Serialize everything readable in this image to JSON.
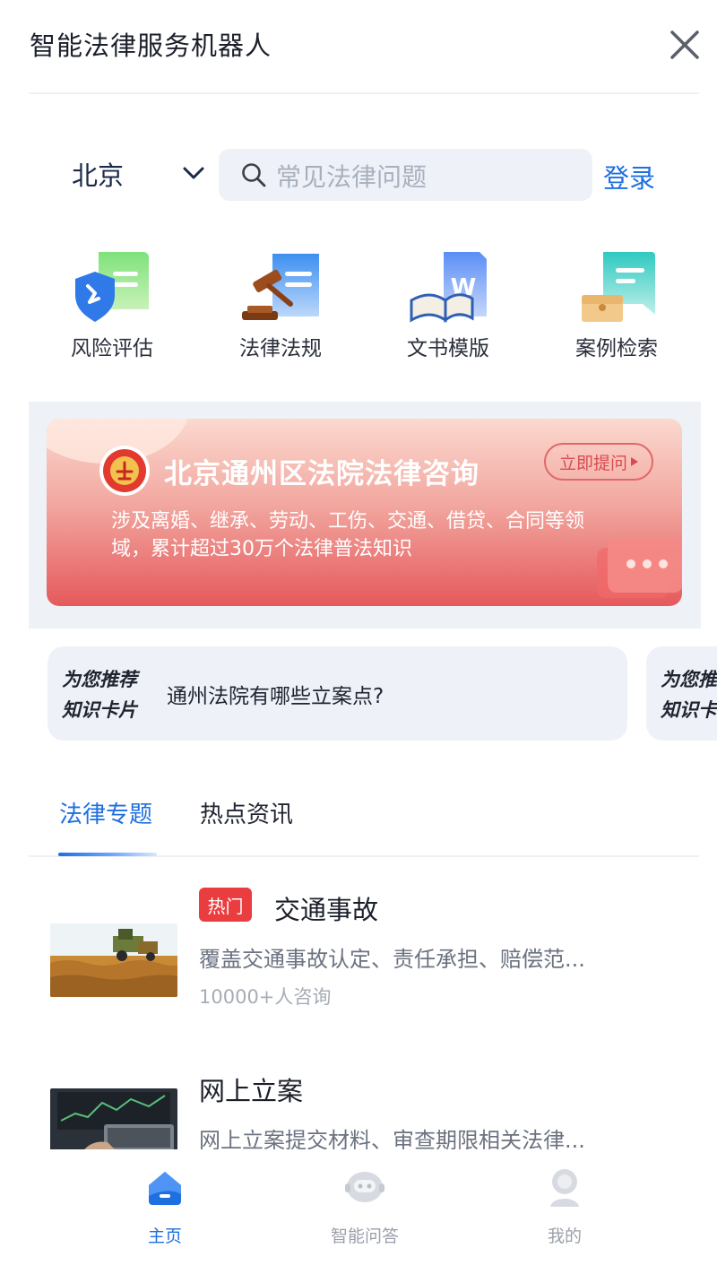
{
  "header": {
    "title": "智能法律服务机器人"
  },
  "search": {
    "city": "北京",
    "placeholder": "常见法律问题",
    "login_label": "登录"
  },
  "quick_entries": [
    {
      "label": "风险评估",
      "icon": "shield-document-icon"
    },
    {
      "label": "法律法规",
      "icon": "gavel-document-icon"
    },
    {
      "label": "文书模版",
      "icon": "word-book-icon"
    },
    {
      "label": "案例检索",
      "icon": "folder-chat-icon"
    }
  ],
  "banner": {
    "title": "北京通州区法院法律咨询",
    "cta_label": "立即提问",
    "description": "涉及离婚、继承、劳动、工伤、交通、借贷、合同等领域，累计超过30万个法律普法知识"
  },
  "knowledge_cards": [
    {
      "tag_line1": "为您推荐",
      "tag_line2": "知识卡片",
      "text": "通州法院有哪些立案点?"
    },
    {
      "tag_line1": "为您推荐",
      "tag_line2": "知识卡片",
      "text": ""
    }
  ],
  "tabs": [
    {
      "label": "法律专题",
      "active": true
    },
    {
      "label": "热点资讯",
      "active": false
    }
  ],
  "topics": [
    {
      "badge": "热门",
      "title": "交通事故",
      "description": "覆盖交通事故认定、责任承担、赔偿范...",
      "meta": "10000+人咨询"
    },
    {
      "badge": "",
      "title": "网上立案",
      "description": "网上立案提交材料、审查期限相关法律...",
      "meta": ""
    }
  ],
  "bottom_nav": [
    {
      "label": "主页",
      "active": true,
      "icon": "home-icon"
    },
    {
      "label": "智能问答",
      "active": false,
      "icon": "robot-icon"
    },
    {
      "label": "我的",
      "active": false,
      "icon": "user-icon"
    }
  ],
  "colors": {
    "accent": "#1e6fe0",
    "hot_badge": "#ea3d3f",
    "inactive": "#9aa0aa"
  }
}
